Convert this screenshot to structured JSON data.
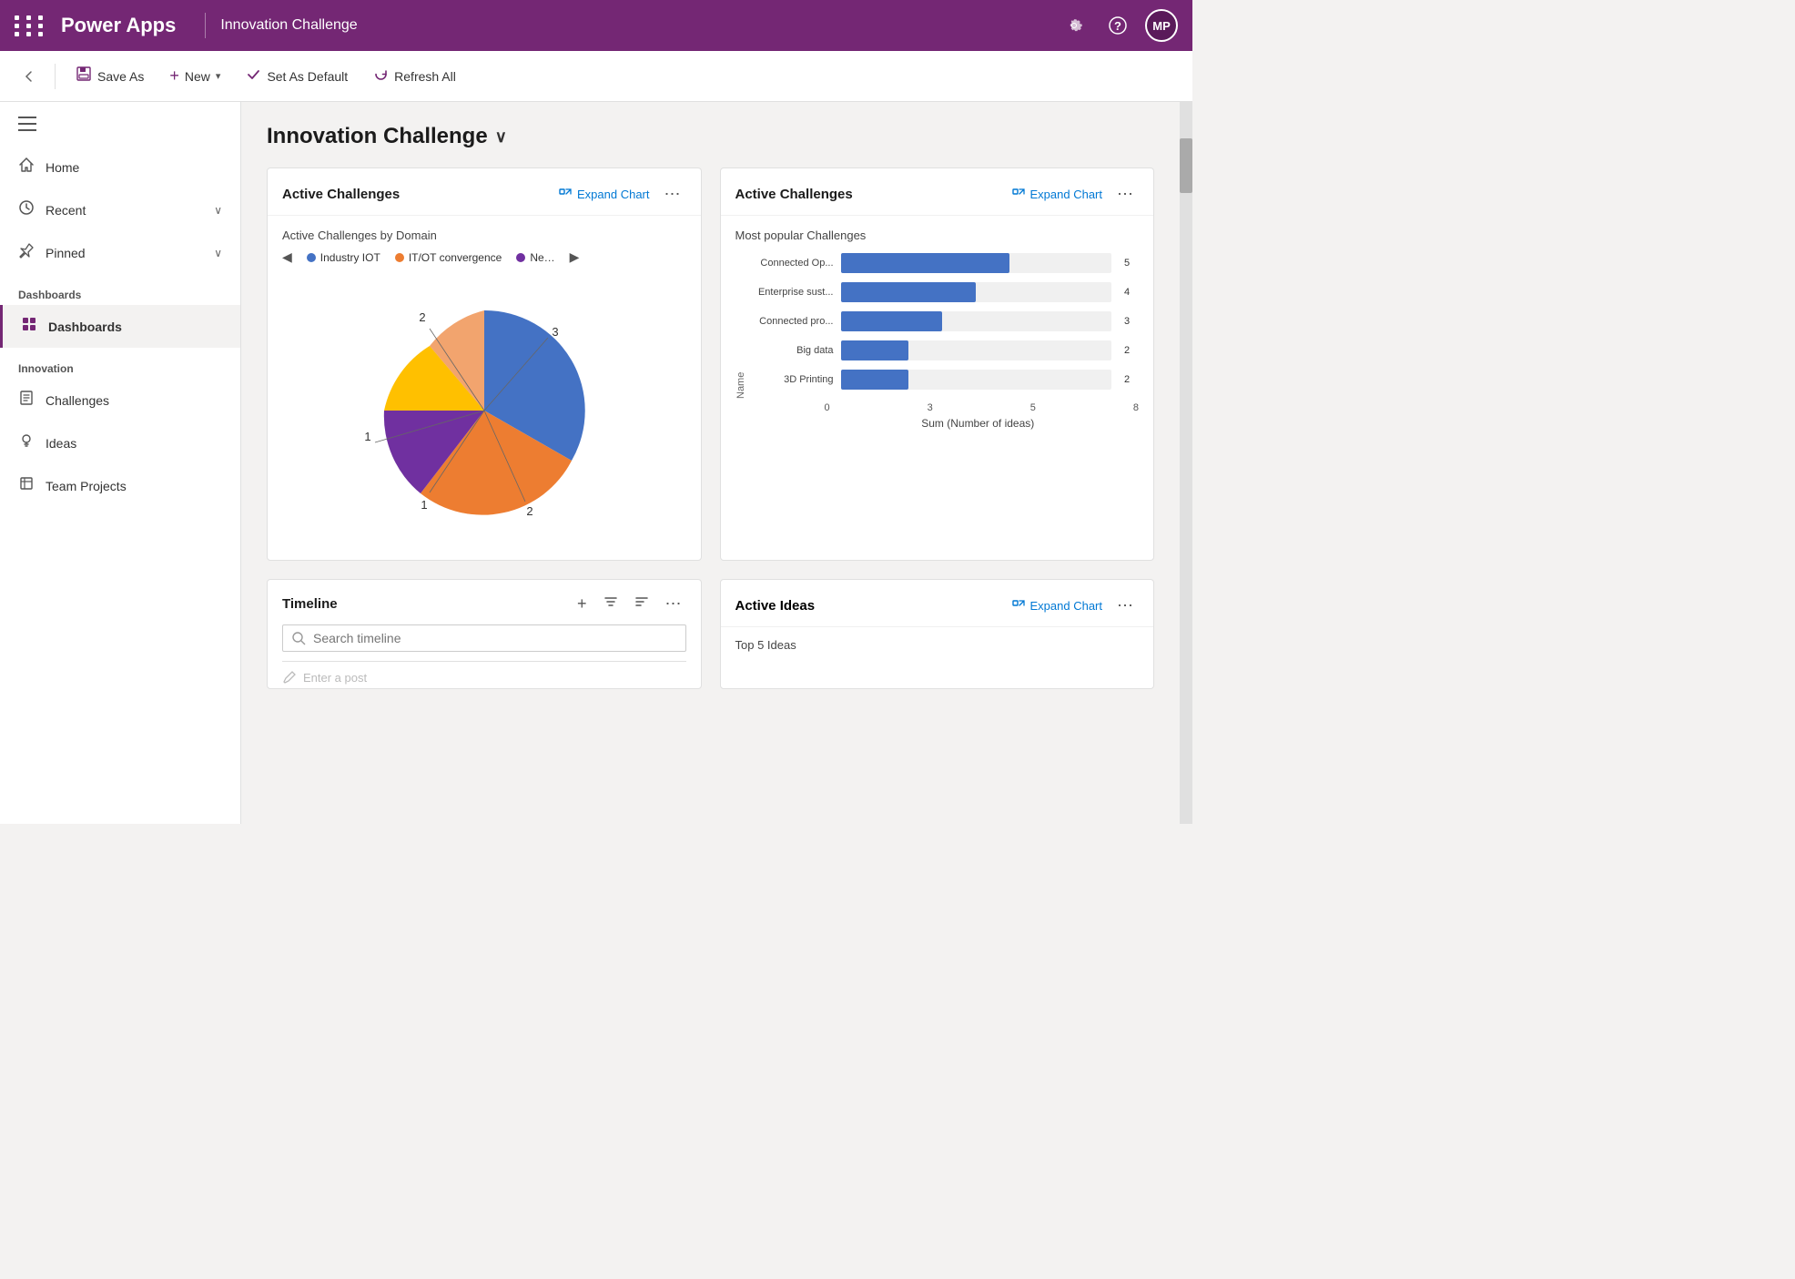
{
  "topNav": {
    "brand": "Power Apps",
    "title": "Innovation Challenge",
    "avatarText": "MP"
  },
  "toolbar": {
    "backArrow": "←",
    "saveAs": "Save As",
    "new": "New",
    "setAsDefault": "Set As Default",
    "refreshAll": "Refresh All",
    "newChevron": "▾"
  },
  "sidebar": {
    "menuIcon": "☰",
    "items": [
      {
        "id": "home",
        "label": "Home",
        "icon": "⌂"
      },
      {
        "id": "recent",
        "label": "Recent",
        "icon": "🕐",
        "chevron": "∨"
      },
      {
        "id": "pinned",
        "label": "Pinned",
        "icon": "📌",
        "chevron": "∨"
      }
    ],
    "sections": [
      {
        "title": "Dashboards",
        "items": [
          {
            "id": "dashboards",
            "label": "Dashboards",
            "icon": "📊",
            "active": true
          }
        ]
      },
      {
        "title": "Innovation",
        "items": [
          {
            "id": "challenges",
            "label": "Challenges",
            "icon": "🗂"
          },
          {
            "id": "ideas",
            "label": "Ideas",
            "icon": "💡"
          },
          {
            "id": "teamprojects",
            "label": "Team Projects",
            "icon": "📋"
          }
        ]
      }
    ]
  },
  "page": {
    "title": "Innovation Challenge",
    "titleChevron": "∨"
  },
  "cards": {
    "activeChallengesPie": {
      "title": "Active Challenges",
      "expandLabel": "Expand Chart",
      "subtitle": "Active Challenges by Domain",
      "legendItems": [
        {
          "label": "Industry IOT",
          "color": "#4472c4"
        },
        {
          "label": "IT/OT convergence",
          "color": "#ed7d31"
        },
        {
          "label": "Ne…",
          "color": "#7030a0"
        }
      ],
      "pieData": [
        {
          "label": "3",
          "value": 3,
          "color": "#4472c4",
          "startAngle": 0,
          "endAngle": 130
        },
        {
          "label": "2",
          "value": 2,
          "color": "#ed7d31",
          "startAngle": 130,
          "endAngle": 220
        },
        {
          "label": "1",
          "value": 1,
          "color": "#7030a0",
          "startAngle": 220,
          "endAngle": 270
        },
        {
          "label": "1",
          "value": 1,
          "color": "#ffc000",
          "startAngle": 270,
          "endAngle": 320
        },
        {
          "label": "2",
          "value": 2,
          "color": "#ed7d31",
          "startAngle": 320,
          "endAngle": 360
        }
      ]
    },
    "activeChallengesBar": {
      "title": "Active Challenges",
      "expandLabel": "Expand Chart",
      "subtitle": "Most popular Challenges",
      "yAxisLabel": "Name",
      "xAxisLabel": "Sum (Number of ideas)",
      "xAxisTicks": [
        "0",
        "3",
        "5",
        "8"
      ],
      "maxValue": 8,
      "bars": [
        {
          "label": "Connected Op...",
          "value": 5
        },
        {
          "label": "Enterprise sust...",
          "value": 4
        },
        {
          "label": "Connected pro...",
          "value": 3
        },
        {
          "label": "Big data",
          "value": 2
        },
        {
          "label": "3D Printing",
          "value": 2
        }
      ]
    },
    "timeline": {
      "title": "Timeline",
      "searchPlaceholder": "Search timeline",
      "postPlaceholder": "Enter a post",
      "actions": [
        "+",
        "⧩",
        "≡",
        "⋮"
      ]
    },
    "activeIdeas": {
      "title": "Active Ideas",
      "expandLabel": "Expand Chart",
      "subtitle": "Top 5 Ideas"
    }
  },
  "icons": {
    "gear": "⚙",
    "question": "?",
    "expandChart": "⤢",
    "more": "⋯",
    "search": "🔍",
    "edit": "✏",
    "plus": "+",
    "filter": "⧩",
    "sort": "≡"
  }
}
